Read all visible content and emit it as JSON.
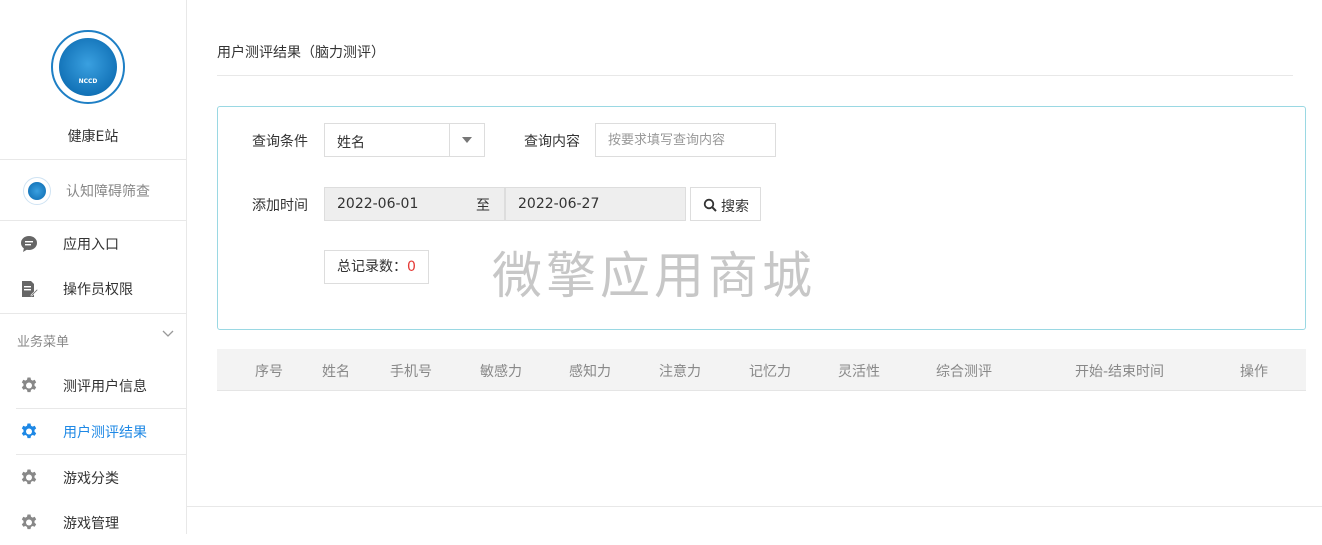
{
  "sidebar": {
    "site_name": "健康E站",
    "logo_text": "NCCD",
    "app_entry": "认知障碍筛查",
    "top_items": [
      {
        "label": "应用入口",
        "icon": "chat-bubble-icon"
      },
      {
        "label": "操作员权限",
        "icon": "document-edit-icon"
      }
    ],
    "group": {
      "label": "业务菜单",
      "icon": "chevron-down-icon"
    },
    "group_items": [
      {
        "label": "测评用户信息",
        "icon": "gear-icon",
        "active": false
      },
      {
        "label": "用户测评结果",
        "icon": "gear-icon",
        "active": true
      },
      {
        "label": "游戏分类",
        "icon": "gear-icon",
        "active": false
      },
      {
        "label": "游戏管理",
        "icon": "gear-icon",
        "active": false
      }
    ]
  },
  "main": {
    "page_title": "用户测评结果（脑力测评）",
    "filters": {
      "condition_label": "查询条件",
      "condition_value": "姓名",
      "content_label": "查询内容",
      "content_placeholder": "按要求填写查询内容",
      "time_label": "添加时间",
      "date_start": "2022-06-01",
      "date_to": "至",
      "date_end": "2022-06-27",
      "search_button": "搜索",
      "count_label": "总记录数：",
      "count_value": "0"
    },
    "watermark": "微擎应用商城",
    "table": {
      "columns": [
        "序号",
        "姓名",
        "手机号",
        "敏感力",
        "感知力",
        "注意力",
        "记忆力",
        "灵活性",
        "综合测评",
        "开始-结束时间",
        "操作"
      ]
    }
  },
  "colors": {
    "accent": "#1e88e5",
    "panel_border": "#9ad8e3",
    "count": "#e53935"
  }
}
